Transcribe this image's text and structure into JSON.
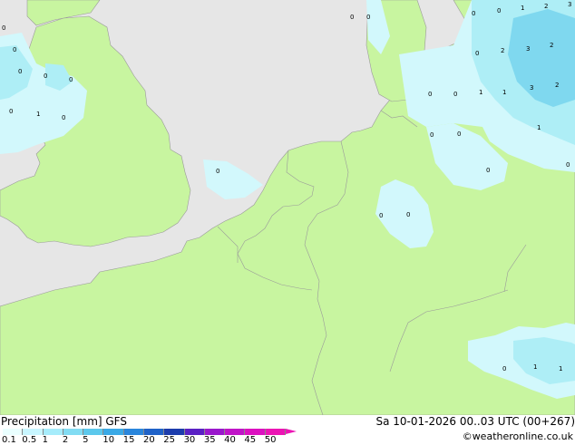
{
  "map": {
    "colors": {
      "sea": "#e6e6e6",
      "land": "#c8f5a0",
      "precip_light": "#d2f8fc",
      "precip_medium": "#aeeef6",
      "precip_heavy": "#7fd8ef",
      "border": "#9a9a9a"
    },
    "labels": [
      "0",
      "0",
      "0",
      "0",
      "0",
      "1",
      "0",
      "0",
      "0",
      "0",
      "0",
      "1",
      "2",
      "3",
      "2",
      "3",
      "2",
      "3",
      "2",
      "1",
      "1",
      "1",
      "0",
      "0",
      "0",
      "0",
      "0",
      "0",
      "0",
      "0",
      "0",
      "0",
      "0",
      "1",
      "0",
      "1"
    ]
  },
  "footer": {
    "title": "Precipitation [mm]  GFS",
    "datetime": "Sa 10-01-2026 00..03 UTC (00+267)",
    "credit": "©weatheronline.co.uk",
    "scale_labels": [
      "0.1",
      "0.5",
      "1",
      "2",
      "5",
      "10",
      "15",
      "20",
      "25",
      "30",
      "35",
      "40",
      "45",
      "50"
    ],
    "scale_colors": [
      "#eaffff",
      "#c8f6ff",
      "#a6ecfb",
      "#82dcf3",
      "#5cc8ec",
      "#3aa9e6",
      "#2a86dc",
      "#1f62c8",
      "#1c3cac",
      "#5a20c4",
      "#9a18cc",
      "#c014c8",
      "#dc10c0",
      "#ec14b4"
    ]
  }
}
